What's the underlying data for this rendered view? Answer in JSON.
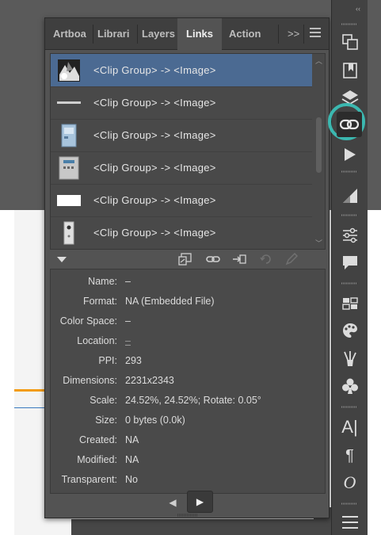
{
  "tabs": [
    {
      "label": "Artboa",
      "active": false
    },
    {
      "label": "Librari",
      "active": false
    },
    {
      "label": "Layers",
      "active": false
    },
    {
      "label": "Links",
      "active": true
    },
    {
      "label": "Action",
      "active": false
    }
  ],
  "overflow_label": ">>",
  "links": [
    {
      "label": "<Clip Group> -> <Image>",
      "selected": true,
      "thumb": "black-white-photo"
    },
    {
      "label": "<Clip Group> -> <Image>",
      "selected": false,
      "thumb": "gray-bar"
    },
    {
      "label": "<Clip Group> -> <Image>",
      "selected": false,
      "thumb": "blue-device"
    },
    {
      "label": "<Clip Group> -> <Image>",
      "selected": false,
      "thumb": "gray-device"
    },
    {
      "label": "<Clip Group> -> <Image>",
      "selected": false,
      "thumb": "white-rectangle"
    },
    {
      "label": "<Clip Group> -> <Image>",
      "selected": false,
      "thumb": "speaker-device"
    }
  ],
  "info": {
    "name": {
      "label": "Name:",
      "value": "–"
    },
    "format": {
      "label": "Format:",
      "value": "NA (Embedded File)"
    },
    "color_space": {
      "label": "Color Space:",
      "value": "–"
    },
    "location": {
      "label": "Location:",
      "value": "–"
    },
    "ppi": {
      "label": "PPI:",
      "value": "293"
    },
    "dimensions": {
      "label": "Dimensions:",
      "value": "2231x2343"
    },
    "scale": {
      "label": "Scale:",
      "value": "24.52%, 24.52%; Rotate: 0.05°"
    },
    "size": {
      "label": "Size:",
      "value": "0 bytes (0.0k)"
    },
    "created": {
      "label": "Created:",
      "value": "NA"
    },
    "modified": {
      "label": "Modified:",
      "value": "NA"
    },
    "transparent": {
      "label": "Transparent:",
      "value": "No"
    }
  },
  "dock_icons": [
    "artboards-icon",
    "libraries-icon",
    "layers-icon",
    "links-icon",
    "actions-icon",
    "gradient-icon",
    "properties-icon",
    "comments-icon",
    "swatches-icon",
    "color-palette-icon",
    "brushes-icon",
    "symbols-icon",
    "character-icon",
    "paragraph-icon",
    "opentype-icon",
    "menu-icon"
  ],
  "colors": {
    "selected_row": "#4b6a92",
    "highlight_ring": "#3bb8b0"
  }
}
